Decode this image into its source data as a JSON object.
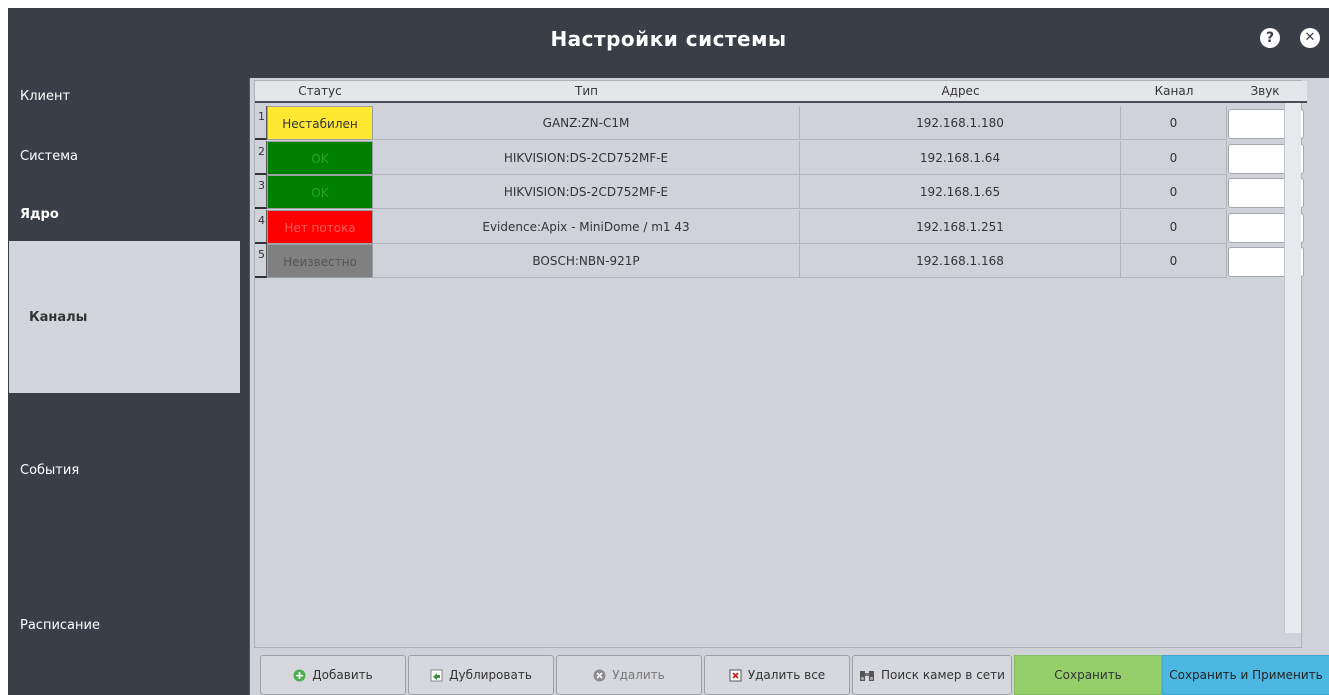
{
  "window": {
    "title": "Настройки системы",
    "help_icon": "?",
    "close_icon": "✕"
  },
  "sidebar": {
    "items": [
      {
        "label": "Клиент"
      },
      {
        "label": "Система"
      },
      {
        "label": "Ядро"
      },
      {
        "label": "Каналы"
      },
      {
        "label": "События"
      },
      {
        "label": "Расписание"
      }
    ]
  },
  "table": {
    "columns": [
      "Статус",
      "Тип",
      "Адрес",
      "Канал",
      "Звук"
    ],
    "rows": [
      {
        "num": "1",
        "status": "Нестабилен",
        "status_color": "#ffe832",
        "status_text_color": "#333333",
        "type": "GANZ:ZN-C1M",
        "address": "192.168.1.180",
        "channel": "0",
        "sound": ""
      },
      {
        "num": "2",
        "status": "OK",
        "status_color": "#008000",
        "status_text_color": "#2ea02e",
        "type": "HIKVISION:DS-2CD752MF-E",
        "address": "192.168.1.64",
        "channel": "0",
        "sound": ""
      },
      {
        "num": "3",
        "status": "OK",
        "status_color": "#008000",
        "status_text_color": "#2ea02e",
        "type": "HIKVISION:DS-2CD752MF-E",
        "address": "192.168.1.65",
        "channel": "0",
        "sound": ""
      },
      {
        "num": "4",
        "status": "Нет потока",
        "status_color": "#ff0000",
        "status_text_color": "#ff5b5b",
        "type": "Evidence:Apix - MiniDome / m1 43",
        "address": "192.168.1.251",
        "channel": "0",
        "sound": ""
      },
      {
        "num": "5",
        "status": "Неизвестно",
        "status_color": "#808080",
        "status_text_color": "#555555",
        "type": "BOSCH:NBN-921P",
        "address": "192.168.1.168",
        "channel": "0",
        "sound": ""
      }
    ]
  },
  "buttons": {
    "add": "Добавить",
    "duplicate": "Дублировать",
    "delete": "Удалить",
    "delete_all": "Удалить все",
    "search": "Поиск камер в сети",
    "save": "Сохранить",
    "save_apply": "Сохранить и Применить"
  },
  "icons": {
    "add": "plus-circle-icon",
    "duplicate": "duplicate-icon",
    "delete": "delete-circle-icon",
    "delete_all": "delete-all-icon",
    "search": "binoculars-icon"
  },
  "colors": {
    "save_green": "#95cf6a",
    "apply_blue": "#4cb8e2"
  }
}
